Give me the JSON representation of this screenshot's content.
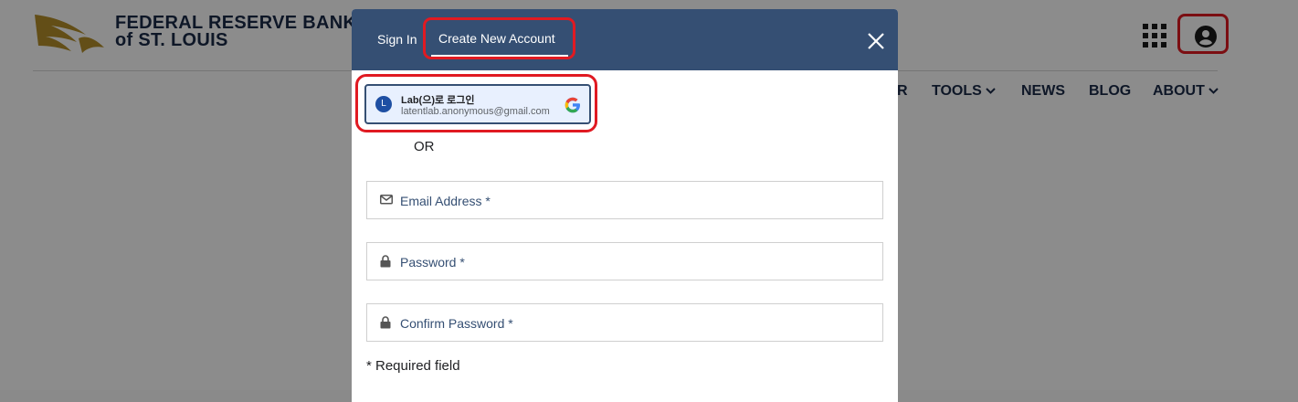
{
  "brand": {
    "line1": "FEDERAL RESERVE BANK",
    "line2": "of ST. LOUIS"
  },
  "header_icons": {
    "apps": "apps-grid-icon",
    "account": "account-circle-icon"
  },
  "nav": {
    "partial_item": "R",
    "items": [
      {
        "label": "TOOLS",
        "has_dropdown": true
      },
      {
        "label": "NEWS",
        "has_dropdown": false
      },
      {
        "label": "BLOG",
        "has_dropdown": false
      },
      {
        "label": "ABOUT",
        "has_dropdown": true
      }
    ]
  },
  "modal": {
    "tabs": {
      "sign_in": "Sign In",
      "create_account": "Create New Account"
    },
    "active_tab": "Create New Account",
    "google": {
      "avatar_letter": "L",
      "name": "Lab(으)로 로그인",
      "email": "latentlab.anonymous@gmail.com"
    },
    "or_text": "OR",
    "fields": {
      "email": "Email Address *",
      "password": "Password *",
      "confirm_password": "Confirm Password *"
    },
    "required_note": "* Required field"
  },
  "colors": {
    "modal_header": "#354f73",
    "highlight": "#e01a22",
    "brand_navy": "#1b2a48",
    "brand_gold": "#b48f2a"
  }
}
